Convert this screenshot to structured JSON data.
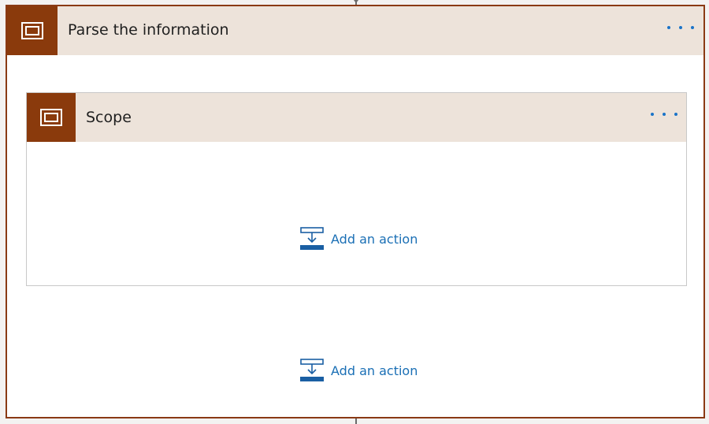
{
  "outer_scope": {
    "title": "Parse the information",
    "icon": "scope-icon",
    "more_icon": "more-options-icon",
    "add_action_label": "Add an action"
  },
  "inner_scope": {
    "title": "Scope",
    "icon": "scope-icon",
    "more_icon": "more-options-icon",
    "add_action_label": "Add an action"
  },
  "colors": {
    "accent": "#8a3a0c",
    "header_bg": "#ede3da",
    "link": "#1a6fb5",
    "dots": "#1a73c8"
  }
}
